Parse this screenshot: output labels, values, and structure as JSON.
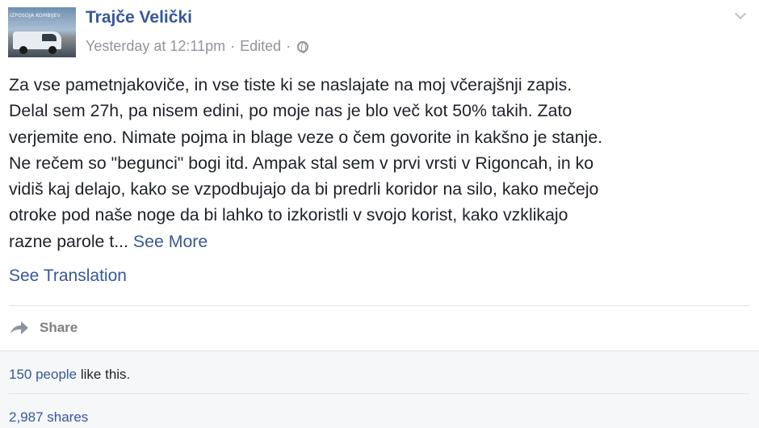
{
  "post": {
    "author": "Trajče Velički",
    "timestamp": "Yesterday at 12:11pm",
    "edited": "Edited",
    "separator": "·",
    "avatar_sign": "IZPOSOJA KOMBIJEV",
    "lines": [
      "Za vse pametnjakoviče, in vse tiste ki se naslajate na moj včerajšnji zapis.",
      "Delal sem 27h, pa nisem edini, po moje nas je blo več kot 50% takih. Zato",
      "verjemite eno. Nimate pojma in blage veze o čem govorite in kakšno je stanje.",
      "Ne rečem so \"begunci\" bogi itd. Ampak stal sem v prvi vrsti v Rigoncah, in ko",
      "vidiš kaj delajo, kako se vzpodbujajo da bi predrli koridor na silo, kako mečejo",
      "otroke pod naše noge da bi lahko to izkoristli v svojo korist, kako vzklikajo"
    ],
    "last_line": "razne parole t...",
    "see_more": "See More",
    "see_translation": "See Translation"
  },
  "actions": {
    "share_label": "Share",
    "share_icon": "share-arrow-icon"
  },
  "stats": {
    "likes_link": "150 people",
    "likes_suffix": " like this.",
    "shares": "2,987 shares"
  },
  "colors": {
    "link": "#365899",
    "meta": "#90949c",
    "stats_bg": "#f6f7f9"
  }
}
